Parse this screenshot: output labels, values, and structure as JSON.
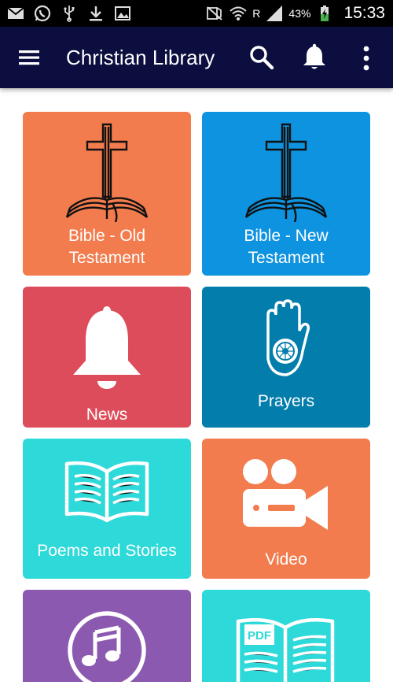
{
  "status_bar": {
    "time": "15:33",
    "battery_percent": "43%",
    "signal_label": "R",
    "icons": [
      "email-icon",
      "whatsapp-icon",
      "usb-icon",
      "download-icon",
      "gallery-icon",
      "mute-icon",
      "wifi-icon",
      "signal-icon",
      "battery-charging-icon"
    ]
  },
  "app_bar": {
    "title": "Christian Library",
    "background": "#0b0e3f",
    "icons": [
      "menu-icon",
      "search-icon",
      "bell-icon",
      "more-vert-icon"
    ]
  },
  "tiles": [
    {
      "label": "Bible - Old Testament",
      "label_line1": "Bible - Old",
      "label_line2": "Testament",
      "color": "#f27c4d",
      "icon": "cross-bible-icon"
    },
    {
      "label": "Bible - New Testament",
      "label_line1": "Bible - New",
      "label_line2": "Testament",
      "color": "#0e93e0",
      "icon": "cross-bible-icon"
    },
    {
      "label": "News",
      "color": "#dd4c5a",
      "icon": "bell-icon"
    },
    {
      "label": "Prayers",
      "color": "#037dab",
      "icon": "hand-chakra-icon"
    },
    {
      "label": "Poems and Stories",
      "color": "#2ed9d9",
      "icon": "open-book-icon"
    },
    {
      "label": "Video",
      "color": "#f27c4d",
      "icon": "video-camera-icon"
    },
    {
      "label": "",
      "color": "#8c59b0",
      "icon": "music-note-icon"
    },
    {
      "label": "",
      "color": "#2ed9d9",
      "icon": "pdf-book-icon"
    }
  ]
}
